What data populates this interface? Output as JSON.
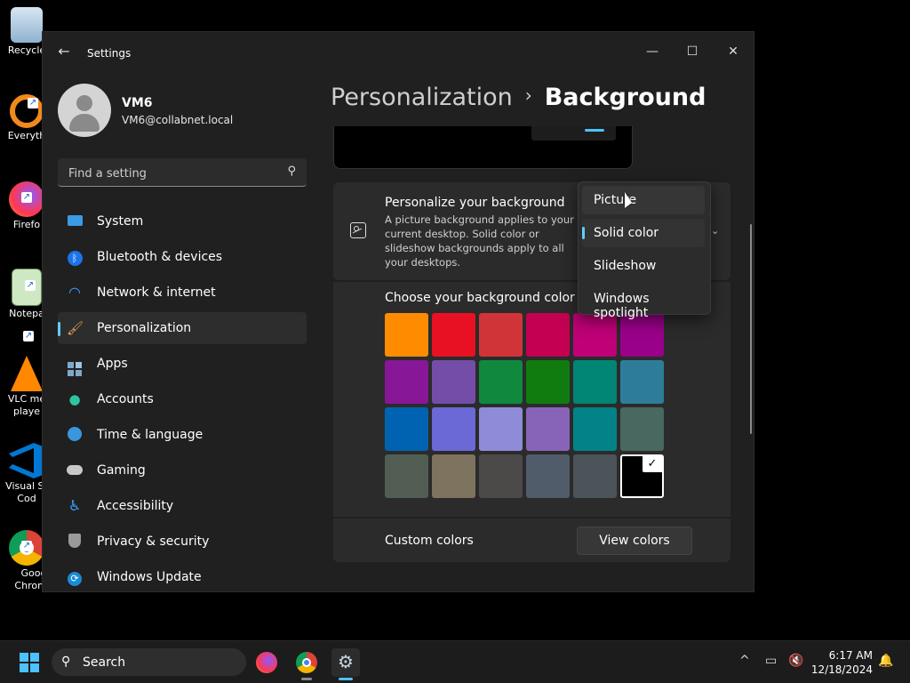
{
  "desktop": {
    "icons": [
      {
        "label": "Recycle",
        "icon": "recycle-bin-icon"
      },
      {
        "label": "Everyth",
        "icon": "everything-search-icon"
      },
      {
        "label": "Firefo",
        "icon": "firefox-icon"
      },
      {
        "label": "Notepa",
        "icon": "notepad-icon"
      },
      {
        "label": "VLC me playe",
        "icon": "vlc-icon"
      },
      {
        "label": "Visual St Cod",
        "icon": "vscode-icon"
      },
      {
        "label": "Goog Chrome",
        "icon": "chrome-icon"
      }
    ]
  },
  "window": {
    "title": "Settings",
    "minimize": "—",
    "maximize": "☐",
    "close": "✕"
  },
  "user": {
    "name": "VM6",
    "email": "VM6@collabnet.local"
  },
  "search": {
    "placeholder": "Find a setting"
  },
  "sidebar": {
    "items": [
      {
        "label": "System",
        "icon": "monitor-icon"
      },
      {
        "label": "Bluetooth & devices",
        "icon": "bluetooth-icon"
      },
      {
        "label": "Network & internet",
        "icon": "wifi-icon"
      },
      {
        "label": "Personalization",
        "icon": "brush-icon",
        "active": true
      },
      {
        "label": "Apps",
        "icon": "apps-icon"
      },
      {
        "label": "Accounts",
        "icon": "person-icon"
      },
      {
        "label": "Time & language",
        "icon": "globe-clock-icon"
      },
      {
        "label": "Gaming",
        "icon": "gamepad-icon"
      },
      {
        "label": "Accessibility",
        "icon": "accessibility-icon"
      },
      {
        "label": "Privacy & security",
        "icon": "shield-icon"
      },
      {
        "label": "Windows Update",
        "icon": "update-icon"
      }
    ]
  },
  "breadcrumb": {
    "parent": "Personalization",
    "separator": "›",
    "current": "Background"
  },
  "personalize": {
    "title": "Personalize your background",
    "description": "A picture background applies to your current desktop. Solid color or slideshow backgrounds apply to all your desktops."
  },
  "dropdown": {
    "options": [
      "Picture",
      "Solid color",
      "Slideshow",
      "Windows spotlight"
    ],
    "selected": "Solid color",
    "hovered": "Picture"
  },
  "colors": {
    "title": "Choose your background color",
    "swatches": [
      [
        "#ff8c00",
        "#e81123",
        "#d13438",
        "#c30052",
        "#bf0077",
        "#9a0089"
      ],
      [
        "#881798",
        "#744da9",
        "#10893e",
        "#107c10",
        "#018574",
        "#2d7d9a"
      ],
      [
        "#0063b1",
        "#6b69d6",
        "#8e8cd8",
        "#8764b8",
        "#038387",
        "#486860"
      ],
      [
        "#525e54",
        "#7e735f",
        "#4c4a48",
        "#515c6b",
        "#4a5459",
        "#000000"
      ]
    ],
    "selected": "#000000",
    "check": "✓"
  },
  "custom": {
    "label": "Custom colors",
    "button": "View colors"
  },
  "taskbar": {
    "search_label": "Search",
    "search_icon": "⚲",
    "tray_chevron": "^",
    "time": "6:17 AM",
    "date": "12/18/2024"
  },
  "accent": "#60cdff"
}
